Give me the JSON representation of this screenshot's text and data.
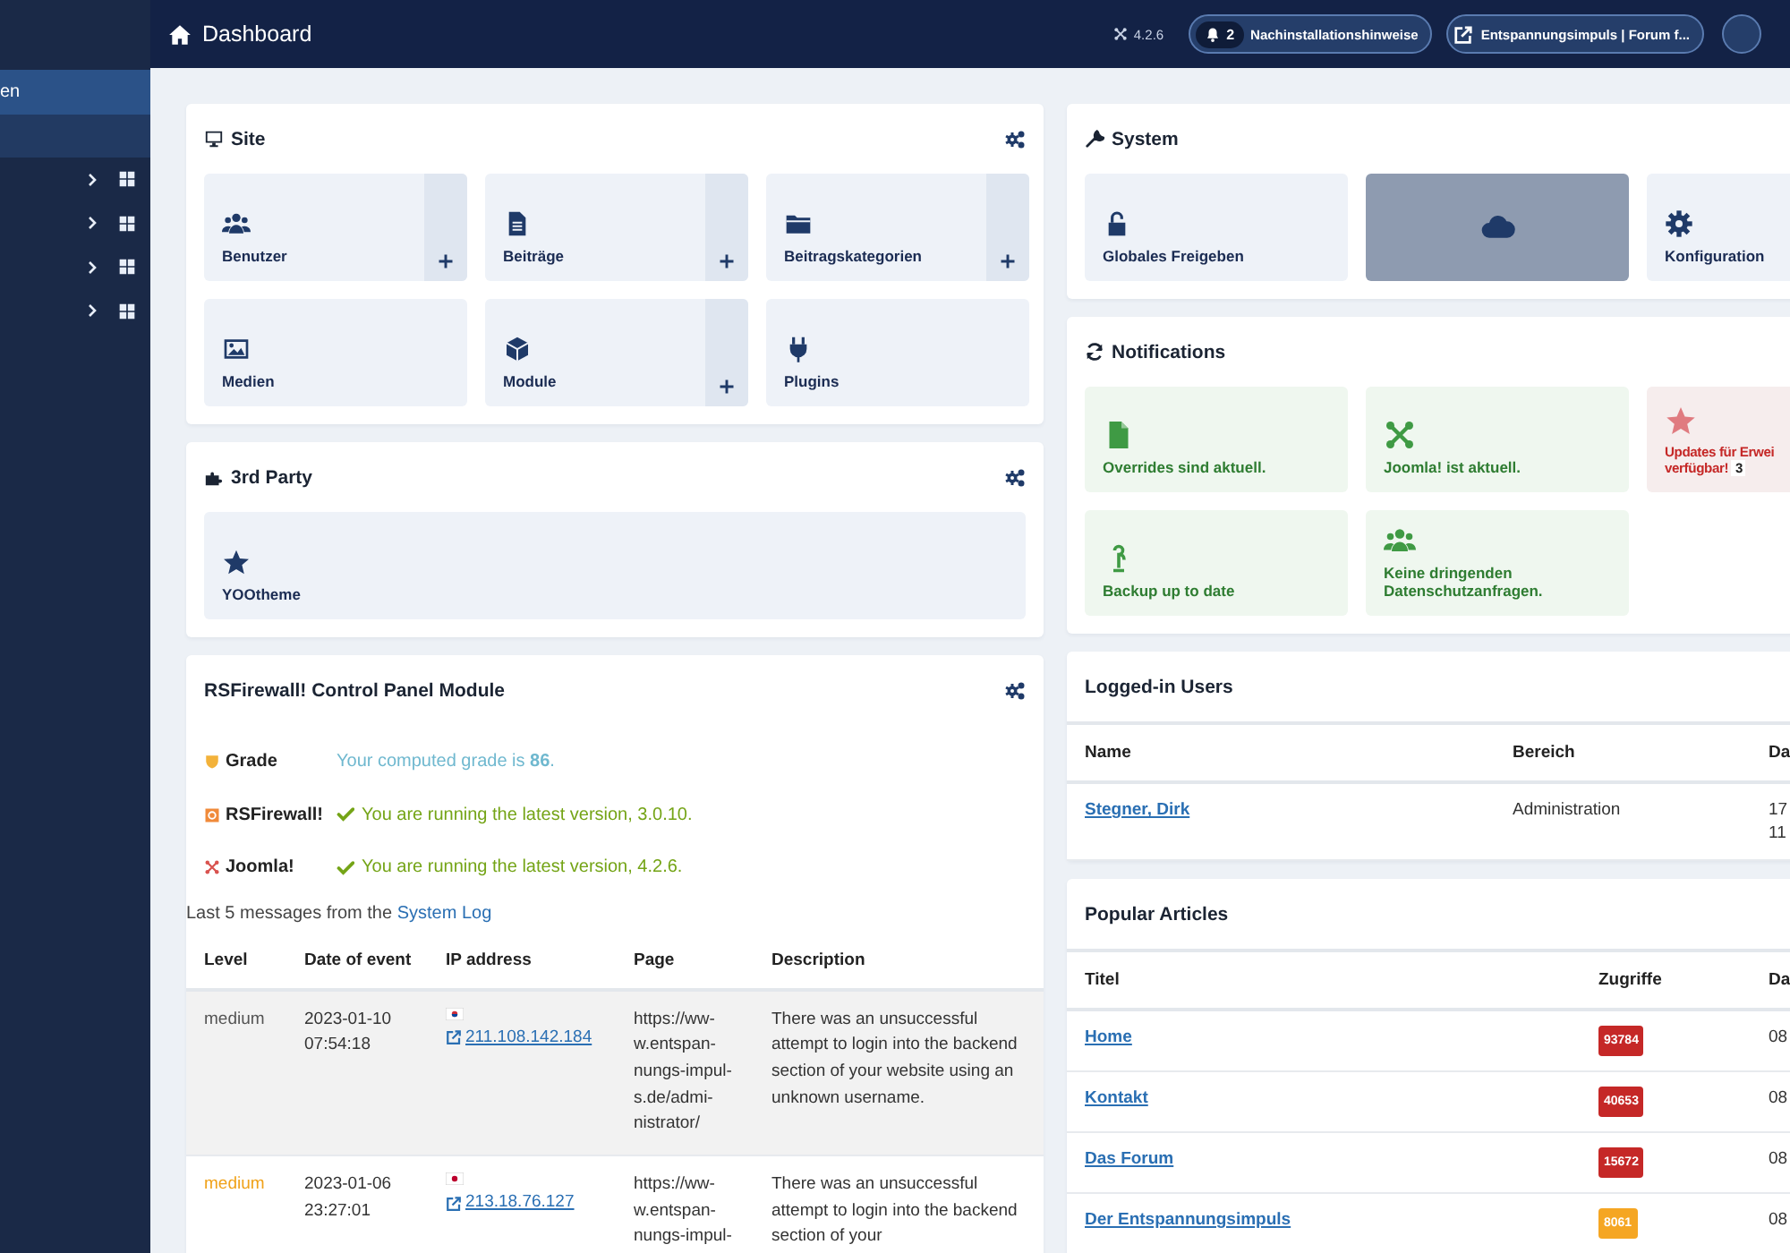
{
  "header": {
    "title": "Dashboard",
    "version": "4.2.6",
    "notices": {
      "count": "2",
      "label": "Nachinstallationshinweise"
    },
    "site_link": "Entspannungsimpuls | Forum f..."
  },
  "sidebar": {
    "items": [
      {
        "kind": "link",
        "label": "en",
        "selected": true
      },
      {
        "kind": "blank",
        "selected": false
      },
      {
        "kind": "group",
        "expanded": false,
        "selected": false
      },
      {
        "kind": "group",
        "expanded": false,
        "selected": false
      },
      {
        "kind": "group",
        "expanded": false,
        "selected": false
      },
      {
        "kind": "group",
        "expanded": false,
        "selected": false
      }
    ]
  },
  "site": {
    "title": "Site",
    "tiles": [
      {
        "label": "Benutzer",
        "add": true
      },
      {
        "label": "Beiträge",
        "add": true
      },
      {
        "label": "Beitragskategorien",
        "add": true
      },
      {
        "label": "Medien",
        "add": false
      },
      {
        "label": "Module",
        "add": true
      },
      {
        "label": "Plugins",
        "add": false
      }
    ]
  },
  "third_party": {
    "title": "3rd Party",
    "tiles": [
      {
        "label": "YOOtheme",
        "add": false
      }
    ]
  },
  "firewall": {
    "title": "RSFirewall! Control Panel Module",
    "status": [
      {
        "kind": "grade",
        "name": "Grade",
        "message": "Your computed grade is **86**."
      },
      {
        "kind": "ok",
        "name": "RSFirewall!",
        "message": "You are running the latest version, 3.0.10."
      },
      {
        "kind": "ok",
        "name": "Joomla!",
        "message": "You are running the latest version, 4.2.6."
      }
    ],
    "log_intro": "Last 5 messages from the",
    "log_link": "System Log",
    "columns": [
      "Level",
      "Date of event",
      "IP address",
      "Page",
      "Description"
    ],
    "rows": [
      {
        "level": "medium",
        "color": "#555555",
        "date": "2023-01-10 07:54:18",
        "ip": "211.108.142.184",
        "page": "https://ww-w.entspan-nungs-impul-s.de/admi-nistrator/",
        "description": "There was an unsuccessful attempt to login into the backend section of your website using an unknown username."
      },
      {
        "level": "medium",
        "color": "#f0a21a",
        "date": "2023-01-06 23:27:01",
        "ip": "213.18.76.127",
        "page": "https://ww-w.entspan-nungs-impul-",
        "description": "There was an unsuccessful attempt to login into the backend section of your"
      }
    ]
  },
  "system": {
    "title": "System",
    "tiles": [
      {
        "label": "Globales Freigeben",
        "disabled": false
      },
      {
        "disabled": true
      },
      {
        "label": "Konfiguration",
        "disabled": false
      }
    ]
  },
  "notifications": {
    "title": "Notifications",
    "tiles": [
      {
        "kind": "ok",
        "label": "Overrides sind aktuell."
      },
      {
        "kind": "ok",
        "label": "Joomla! ist aktuell."
      },
      {
        "kind": "alert",
        "label": "Updates für Erwei",
        "label_2": "verfügbar!",
        "count": "3"
      },
      {
        "kind": "ok",
        "label": "Backup up to date"
      },
      {
        "kind": "ok",
        "label": "Keine dringenden Datenschutzanfragen."
      }
    ]
  },
  "logged_in": {
    "title": "Logged-in Users",
    "columns": [
      "Name",
      "Bereich",
      "Da"
    ],
    "rows": [
      {
        "name": "Stegner, Dirk",
        "area": "Administration",
        "date_lines": [
          "17",
          "11"
        ]
      }
    ]
  },
  "popular": {
    "title": "Popular Articles",
    "columns": [
      "Titel",
      "Zugriffe",
      "Da"
    ],
    "rows": [
      {
        "title": "Home",
        "hits": "93784",
        "color": "#c52827",
        "date": "08"
      },
      {
        "title": "Kontakt",
        "hits": "40653",
        "color": "#c52827",
        "date": "08"
      },
      {
        "title": "Das Forum",
        "hits": "15672",
        "color": "#c52827",
        "date": "08"
      },
      {
        "title": "Der Entspannungsimpuls",
        "hits": "8061",
        "color": "#f5a623",
        "date": "08"
      }
    ]
  }
}
